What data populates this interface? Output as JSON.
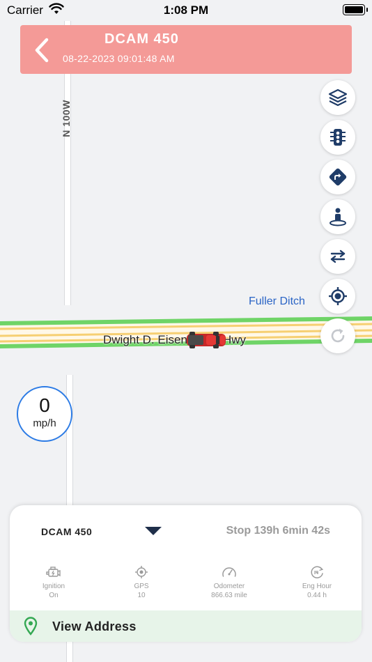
{
  "status_bar": {
    "carrier": "Carrier",
    "time": "1:08 PM"
  },
  "header": {
    "title": "DCAM 450",
    "timestamp": "08-22-2023 09:01:48 AM"
  },
  "map": {
    "road_vertical_label": "N 100W",
    "place_label": "Fuller Ditch",
    "highway_label": "Dwight D. Eisenhower Hwy"
  },
  "map_controls": [
    {
      "icon": "layers-icon"
    },
    {
      "icon": "traffic-light-icon"
    },
    {
      "icon": "directions-icon"
    },
    {
      "icon": "street-view-icon"
    },
    {
      "icon": "swap-icon"
    },
    {
      "icon": "locate-icon"
    },
    {
      "icon": "refresh-icon"
    }
  ],
  "speed": {
    "value": "0",
    "unit": "mp/h"
  },
  "panel": {
    "device_name": "DCAM 450",
    "stop_status": "Stop 139h 6min 42s",
    "stats": [
      {
        "icon": "engine-icon",
        "label": "Ignition",
        "value": "On"
      },
      {
        "icon": "gps-icon",
        "label": "GPS",
        "value": "10"
      },
      {
        "icon": "odometer-icon",
        "label": "Odometer",
        "value": "866.63 mile"
      },
      {
        "icon": "engine-hours-icon",
        "label": "Eng Hour",
        "value": "0.44 h"
      }
    ],
    "address_label": "View Address"
  },
  "colors": {
    "header_bg": "#f49a97",
    "icon_navy": "#1f3c68",
    "speed_ring": "#2c7be5",
    "address_bg": "#e7f4e9",
    "pin_green": "#34a853",
    "highway_green": "#5ed15e",
    "highway_yellow": "#f7d98a",
    "vehicle_red": "#d32f2f"
  }
}
